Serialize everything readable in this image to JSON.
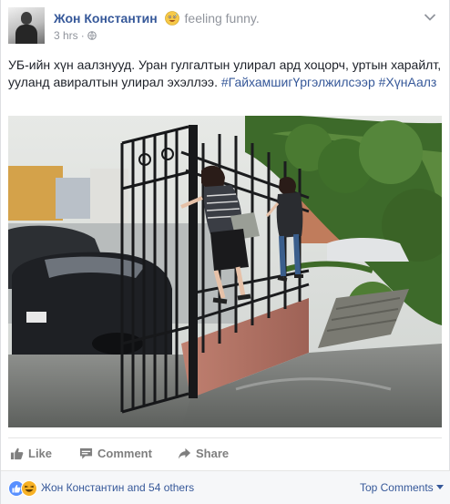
{
  "post": {
    "author": "Жон Константин",
    "feeling": "feeling funny.",
    "time": "3 hrs",
    "separator": "·",
    "text": "УБ-ийн хүн аалзнууд. Уран гулгалтын улирал ард хоцорч, уртын харайлт, ууланд авиралтын улирал эхэллээ.",
    "hashtags": [
      "#ГайхамшигҮргэлжилсээр",
      "#ХүнАалз"
    ]
  },
  "photo": {
    "description_icon": "photo-icon"
  },
  "actions": {
    "like": "Like",
    "comment": "Comment",
    "share": "Share"
  },
  "summary": {
    "text": "Жон Константин and 54 others",
    "top_comments": "Top Comments"
  },
  "colors": {
    "link": "#365899",
    "meta": "#90949c",
    "action": "#7f7f7f",
    "like_blue": "#5890ff",
    "haha_yellow": "#f7b125"
  },
  "icons": {
    "feeling": "sweat-smile-emoji-icon",
    "privacy": "globe-icon",
    "options": "chevron-down-icon",
    "like": "thumbs-up-icon",
    "comment": "comment-bubble-icon",
    "share": "share-arrow-icon",
    "reaction_like": "like-reaction-icon",
    "reaction_haha": "haha-reaction-icon",
    "top_comments_caret": "caret-down-icon"
  }
}
